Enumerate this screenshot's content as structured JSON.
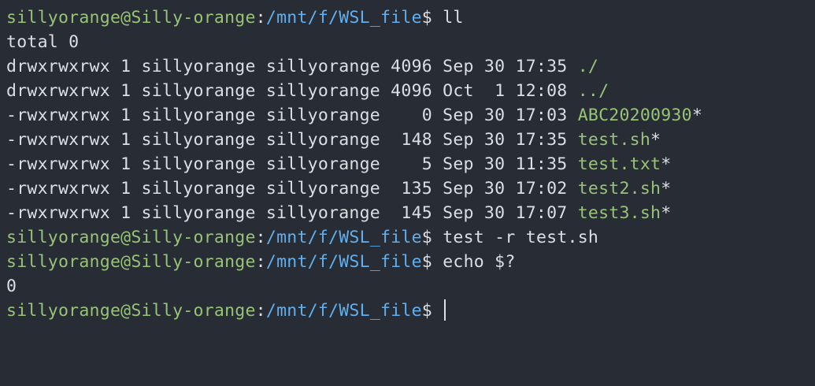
{
  "prompt": {
    "user_host": "sillyorange@Silly-orange",
    "sep": ":",
    "path": "/mnt/f/WSL_file",
    "symbol": "$"
  },
  "colors": {
    "background": "#282c34",
    "text": "#dcdfe4",
    "user_host": "#98c379",
    "path": "#61afef",
    "filename": "#98c379",
    "cursor": "#dcdfe4"
  },
  "lines": [
    {
      "type": "prompt",
      "command": " ll"
    },
    {
      "type": "output",
      "text": "total 0"
    },
    {
      "type": "listing",
      "info": "drwxrwxrwx 1 sillyorange sillyorange 4096 Sep 30 17:35 ",
      "name": "./",
      "suffix": ""
    },
    {
      "type": "listing",
      "info": "drwxrwxrwx 1 sillyorange sillyorange 4096 Oct  1 12:08 ",
      "name": "../",
      "suffix": ""
    },
    {
      "type": "listing",
      "info": "-rwxrwxrwx 1 sillyorange sillyorange    0 Sep 30 17:03 ",
      "name": "ABC20200930",
      "suffix": "*"
    },
    {
      "type": "listing",
      "info": "-rwxrwxrwx 1 sillyorange sillyorange  148 Sep 30 17:35 ",
      "name": "test.sh",
      "suffix": "*"
    },
    {
      "type": "listing",
      "info": "-rwxrwxrwx 1 sillyorange sillyorange    5 Sep 30 11:35 ",
      "name": "test.txt",
      "suffix": "*"
    },
    {
      "type": "listing",
      "info": "-rwxrwxrwx 1 sillyorange sillyorange  135 Sep 30 17:02 ",
      "name": "test2.sh",
      "suffix": "*"
    },
    {
      "type": "listing",
      "info": "-rwxrwxrwx 1 sillyorange sillyorange  145 Sep 30 17:07 ",
      "name": "test3.sh",
      "suffix": "*"
    },
    {
      "type": "prompt",
      "command": " test -r test.sh"
    },
    {
      "type": "prompt",
      "command": " echo $?"
    },
    {
      "type": "output",
      "text": "0"
    },
    {
      "type": "prompt",
      "command": " ",
      "cursor": true
    }
  ]
}
